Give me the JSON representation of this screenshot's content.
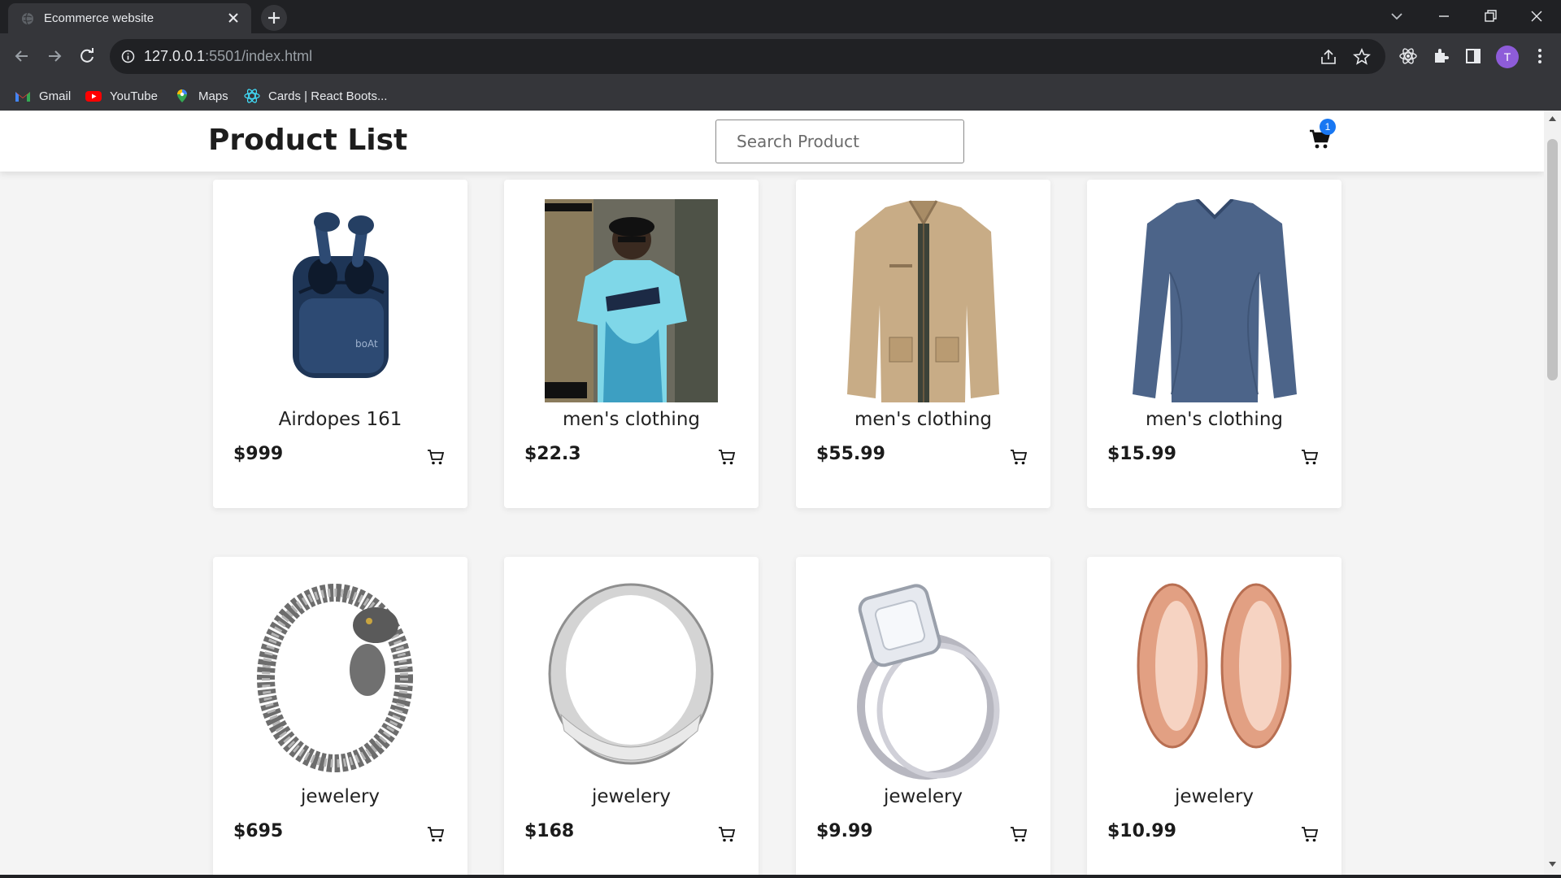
{
  "browser": {
    "tab_title": "Ecommerce website",
    "url_host": "127.0.0.1",
    "url_rest": ":5501/index.html",
    "profile_initial": "T",
    "bookmarks": [
      {
        "label": "Gmail",
        "icon": "gmail-icon"
      },
      {
        "label": "YouTube",
        "icon": "youtube-icon"
      },
      {
        "label": "Maps",
        "icon": "maps-icon"
      },
      {
        "label": "Cards | React Boots...",
        "icon": "react-bootstrap-icon"
      }
    ]
  },
  "header": {
    "title": "Product List",
    "search_placeholder": "Search Product",
    "cart_count": "1",
    "accent": "#1877f2"
  },
  "products": [
    {
      "name": "Airdopes 161",
      "price": "$999",
      "image": "earbuds"
    },
    {
      "name": "men's clothing",
      "price": "$22.3",
      "image": "tshirt-model"
    },
    {
      "name": "men's clothing",
      "price": "$55.99",
      "image": "jacket"
    },
    {
      "name": "men's clothing",
      "price": "$15.99",
      "image": "longsleeve"
    },
    {
      "name": "jewelery",
      "price": "$695",
      "image": "bracelet"
    },
    {
      "name": "jewelery",
      "price": "$168",
      "image": "silver-ring"
    },
    {
      "name": "jewelery",
      "price": "$9.99",
      "image": "diamond-ring"
    },
    {
      "name": "jewelery",
      "price": "$10.99",
      "image": "rose-gold-plugs"
    }
  ]
}
